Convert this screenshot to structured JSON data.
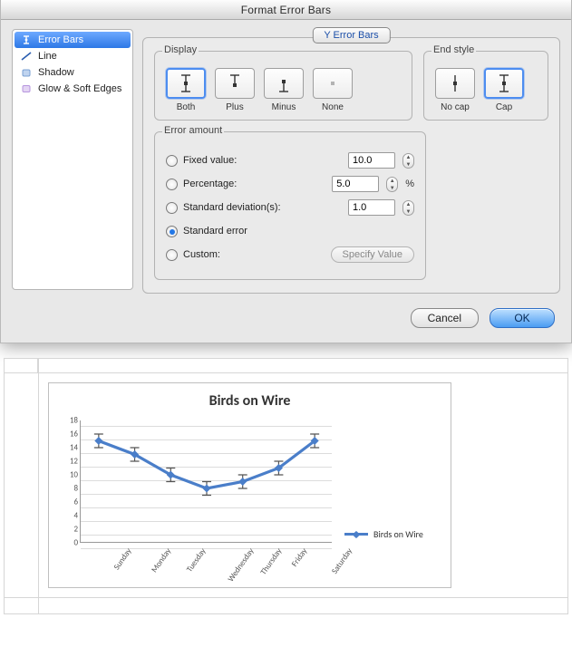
{
  "dialog": {
    "title": "Format Error Bars",
    "tab_label": "Y Error Bars",
    "sidebar_items": [
      {
        "label": "Error Bars",
        "selected": true
      },
      {
        "label": "Line",
        "selected": false
      },
      {
        "label": "Shadow",
        "selected": false
      },
      {
        "label": "Glow & Soft Edges",
        "selected": false
      }
    ],
    "display": {
      "title": "Display",
      "options": [
        {
          "label": "Both",
          "selected": true
        },
        {
          "label": "Plus",
          "selected": false
        },
        {
          "label": "Minus",
          "selected": false
        },
        {
          "label": "None",
          "selected": false
        }
      ]
    },
    "end_style": {
      "title": "End style",
      "options": [
        {
          "label": "No cap",
          "selected": false
        },
        {
          "label": "Cap",
          "selected": true
        }
      ]
    },
    "error_amount": {
      "title": "Error amount",
      "fixed_label": "Fixed value:",
      "fixed_value": "10.0",
      "percentage_label": "Percentage:",
      "percentage_value": "5.0",
      "percent_sign": "%",
      "stddev_label": "Standard deviation(s):",
      "stddev_value": "1.0",
      "stderr_label": "Standard error",
      "custom_label": "Custom:",
      "specify_label": "Specify Value",
      "selected": "stderr"
    },
    "cancel_label": "Cancel",
    "ok_label": "OK"
  },
  "chart_data": {
    "type": "line",
    "title": "Birds on Wire",
    "categories": [
      "Sunday",
      "Monday",
      "Tuesday",
      "Wednesday",
      "Thursday",
      "Friday",
      "Saturday"
    ],
    "series": [
      {
        "name": "Birds on Wire",
        "values": [
          15,
          13,
          10,
          8,
          9,
          11,
          15
        ],
        "error": [
          1,
          1,
          1,
          1,
          1,
          1,
          1
        ]
      }
    ],
    "ylim": [
      0,
      18
    ],
    "yticks": [
      0,
      2,
      4,
      6,
      8,
      10,
      12,
      14,
      16,
      18
    ],
    "xlabel": "",
    "ylabel": "",
    "legend_position": "right"
  }
}
